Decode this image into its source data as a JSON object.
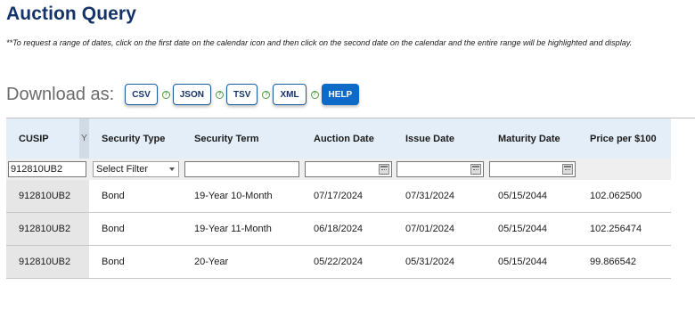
{
  "page": {
    "title": "Auction Query",
    "note": "**To request a range of dates, click on the first date on the calendar icon and then click on the second date on the calendar and the entire range will be highlighted and display."
  },
  "download": {
    "label": "Download as:",
    "buttons": [
      "CSV",
      "JSON",
      "TSV",
      "XML",
      "HELP"
    ],
    "help_glyph": "?",
    "accent": "#0d6bc7"
  },
  "grid": {
    "columns": [
      "CUSIP",
      "Security Type",
      "Security Term",
      "Auction Date",
      "Issue Date",
      "Maturity Date",
      "Price per $100"
    ],
    "filter_glyph": "Y",
    "filters": {
      "cusip_value": "912810UB2",
      "security_type_value": "Select Filter",
      "security_term_value": "",
      "auction_date_value": "",
      "issue_date_value": "",
      "maturity_date_value": ""
    },
    "rows": [
      [
        "912810UB2",
        "Bond",
        "19-Year 10-Month",
        "07/17/2024",
        "07/31/2024",
        "05/15/2044",
        "102.062500"
      ],
      [
        "912810UB2",
        "Bond",
        "19-Year 11-Month",
        "06/18/2024",
        "07/01/2024",
        "05/15/2044",
        "102.256474"
      ],
      [
        "912810UB2",
        "Bond",
        "20-Year",
        "05/22/2024",
        "05/31/2024",
        "05/15/2044",
        "99.866542"
      ]
    ]
  }
}
